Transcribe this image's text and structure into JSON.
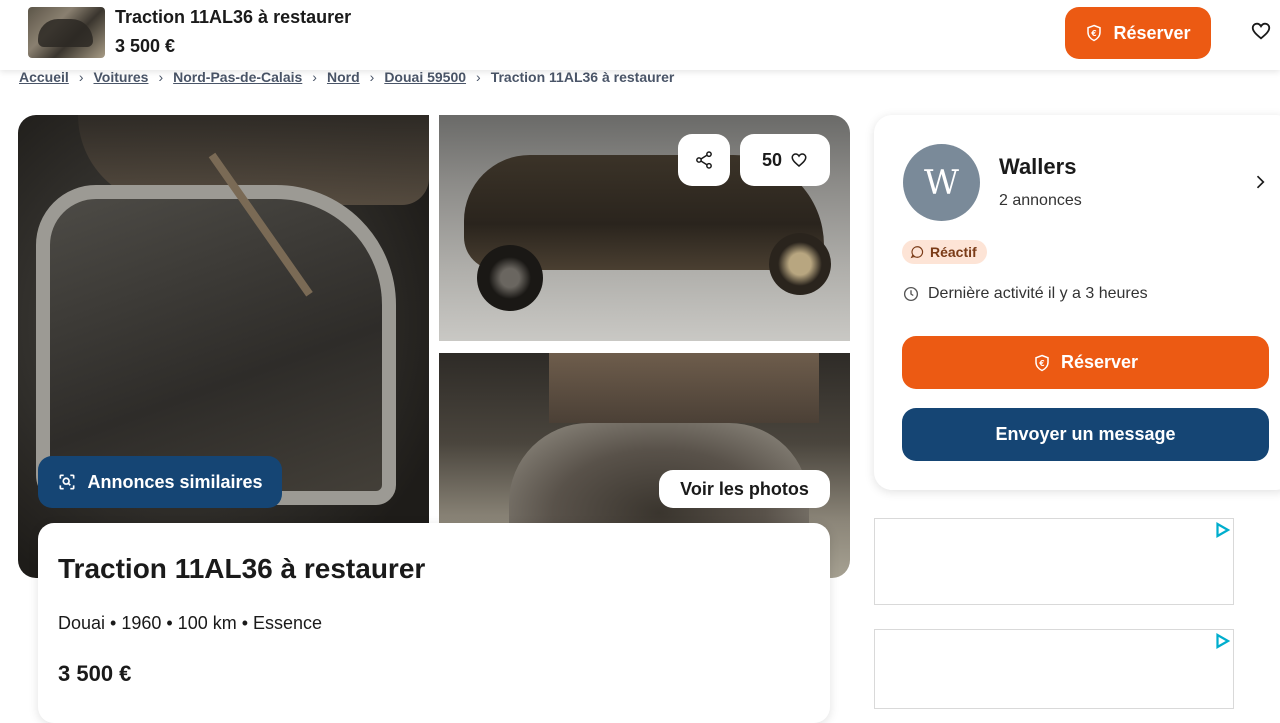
{
  "header": {
    "title": "Traction 11AL36 à restaurer",
    "price": "3 500 €",
    "reserve_label": "Réserver"
  },
  "breadcrumb": {
    "items": [
      "Accueil",
      "Voitures",
      "Nord-Pas-de-Calais",
      "Nord",
      "Douai 59500"
    ],
    "current": "Traction 11AL36 à restaurer"
  },
  "gallery": {
    "favorites_count": "50",
    "similar_label": "Annonces similaires",
    "photos_label": "Voir les photos"
  },
  "listing": {
    "title": "Traction 11AL36 à restaurer",
    "meta": "Douai • 1960 • 100 km • Essence",
    "price": "3 500 €"
  },
  "seller": {
    "initial": "W",
    "name": "Wallers",
    "ads_count": "2 annonces",
    "badge": "Réactif",
    "activity": "Dernière activité il y a 3 heures",
    "reserve_label": "Réserver",
    "message_label": "Envoyer un message"
  },
  "colors": {
    "accent_orange": "#ec5a13",
    "accent_blue": "#154574",
    "badge_bg": "#fde4d6"
  },
  "icons": [
    "shield-euro-icon",
    "heart-icon",
    "share-icon",
    "search-image-icon",
    "chevron-right-icon",
    "chat-icon",
    "clock-icon",
    "ad-choices-icon"
  ]
}
